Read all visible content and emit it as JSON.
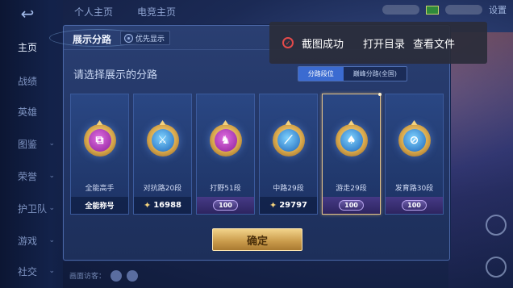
{
  "nav": {
    "back_glyph": "↩",
    "items": [
      {
        "label": "主页",
        "active": true,
        "chevron": false
      },
      {
        "label": "战绩",
        "active": false,
        "chevron": false
      },
      {
        "label": "英雄",
        "active": false,
        "chevron": false
      },
      {
        "label": "图鉴",
        "active": false,
        "chevron": true
      },
      {
        "label": "荣誉",
        "active": false,
        "chevron": true
      },
      {
        "label": "护卫队",
        "active": false,
        "chevron": true
      },
      {
        "label": "游戏",
        "active": false,
        "chevron": true
      },
      {
        "label": "社交",
        "active": false,
        "chevron": true
      }
    ],
    "chevron_glyph": "⌄"
  },
  "top_tabs": [
    "个人主页",
    "电竞主页"
  ],
  "top_right": {
    "settings_label": "设置"
  },
  "panel": {
    "title": "展示分路",
    "priority_label": "优先显示",
    "subtitle": "请选择展示的分路",
    "segments": [
      "分路段位",
      "巅峰分路(全国)"
    ],
    "active_segment_index": 0,
    "confirm_label": "确定"
  },
  "cards": [
    {
      "name": "全能高手",
      "foot_type": "text",
      "foot_text": "全能称号",
      "emblem": "purple",
      "emblem_glyph": "⧉",
      "selected": false
    },
    {
      "name": "对抗路20段",
      "foot_type": "points",
      "foot_text": "16988",
      "emblem": "blue",
      "emblem_glyph": "⚔",
      "selected": false
    },
    {
      "name": "打野51段",
      "foot_type": "badge",
      "foot_text": "100",
      "emblem": "purple",
      "emblem_glyph": "♞",
      "selected": false
    },
    {
      "name": "中路29段",
      "foot_type": "points",
      "foot_text": "29797",
      "emblem": "blue",
      "emblem_glyph": "⟋",
      "selected": false
    },
    {
      "name": "游走29段",
      "foot_type": "badge",
      "foot_text": "100",
      "emblem": "blue",
      "emblem_glyph": "♠",
      "selected": true
    },
    {
      "name": "发育路30段",
      "foot_type": "badge",
      "foot_text": "100",
      "emblem": "blue",
      "emblem_glyph": "⊘",
      "selected": false
    }
  ],
  "bottom": {
    "text": "画面访客："
  },
  "toast": {
    "message": "截图成功",
    "open_dir_label": "打开目录",
    "view_file_label": "查看文件",
    "status_glyph": "✓"
  },
  "colors": {
    "accent_gold": "#e3c28a",
    "segment_active": "#3b6bd1",
    "toast_bg": "#2a2c3a",
    "toast_icon": "#e34a4a"
  },
  "icons": [
    "back-icon",
    "gear-icon",
    "star-icon",
    "check-icon",
    "chevron-down-icon",
    "flag-icon"
  ]
}
